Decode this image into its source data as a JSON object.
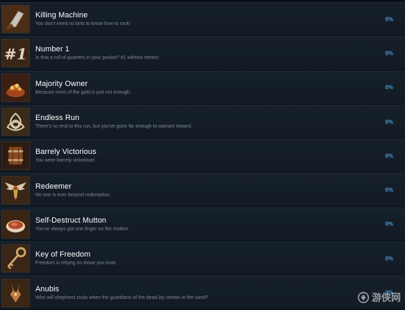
{
  "achievements": [
    {
      "name": "Killing Machine",
      "description": "You don't need no bots to know how to rock!",
      "percent": "0%",
      "icon": "cleaver-icon"
    },
    {
      "name": "Number 1",
      "description": "Is that a roll of quarters in your pocket? #1 without retries!",
      "percent": "0%",
      "icon": "number-one-icon"
    },
    {
      "name": "Majority Owner",
      "description": "Because most of the gold is just not enough.",
      "percent": "0%",
      "icon": "treasure-icon"
    },
    {
      "name": "Endless Run",
      "description": "There's no end to this run, but you've gone far enough to warrant reward.",
      "percent": "0%",
      "icon": "triquetra-icon"
    },
    {
      "name": "Barrely Victorious",
      "description": "You were barrely victorious!",
      "percent": "0%",
      "icon": "barrel-icon"
    },
    {
      "name": "Redeemer",
      "description": "No one is ever beyond redemption.",
      "percent": "0%",
      "icon": "winged-emblem-icon"
    },
    {
      "name": "Self-Destruct Mutton",
      "description": "You've always got one finger on the mutton.",
      "percent": "0%",
      "icon": "mutton-icon"
    },
    {
      "name": "Key of Freedom",
      "description": "Freedom is relying on those you trust.",
      "percent": "0%",
      "icon": "key-icon"
    },
    {
      "name": "Anubis",
      "description": "Who will shepherd souls when the guardians of the dead lay strewn in the sand?",
      "percent": "0%",
      "icon": "anubis-icon"
    }
  ],
  "colors": {
    "percent": "#4a9bd6",
    "description": "#7e8a94",
    "row_background": "#141d27"
  },
  "watermark": {
    "text": "游侠网",
    "icon": "watermark-logo-icon"
  }
}
